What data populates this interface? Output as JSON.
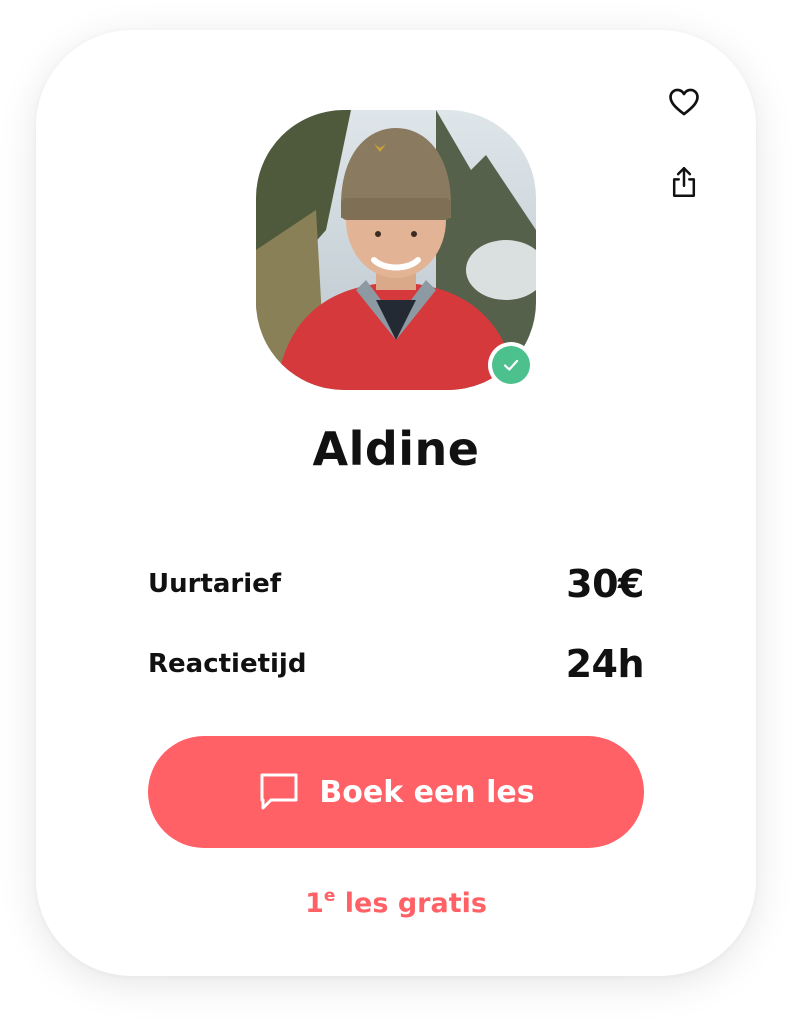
{
  "colors": {
    "accent": "#ff6166",
    "verified": "#4cc08d",
    "text": "#111111"
  },
  "actions": {
    "favorite_icon": "heart-icon",
    "share_icon": "share-icon"
  },
  "profile": {
    "name": "Aldine",
    "verified_icon": "check-icon"
  },
  "stats": [
    {
      "label": "Uurtarief",
      "value": "30€"
    },
    {
      "label": "Reactietijd",
      "value": "24h"
    }
  ],
  "cta": {
    "label": "Boek een les",
    "icon": "chat-bubble-icon"
  },
  "promo": {
    "number": "1",
    "superscript": "e",
    "text": " les gratis"
  }
}
